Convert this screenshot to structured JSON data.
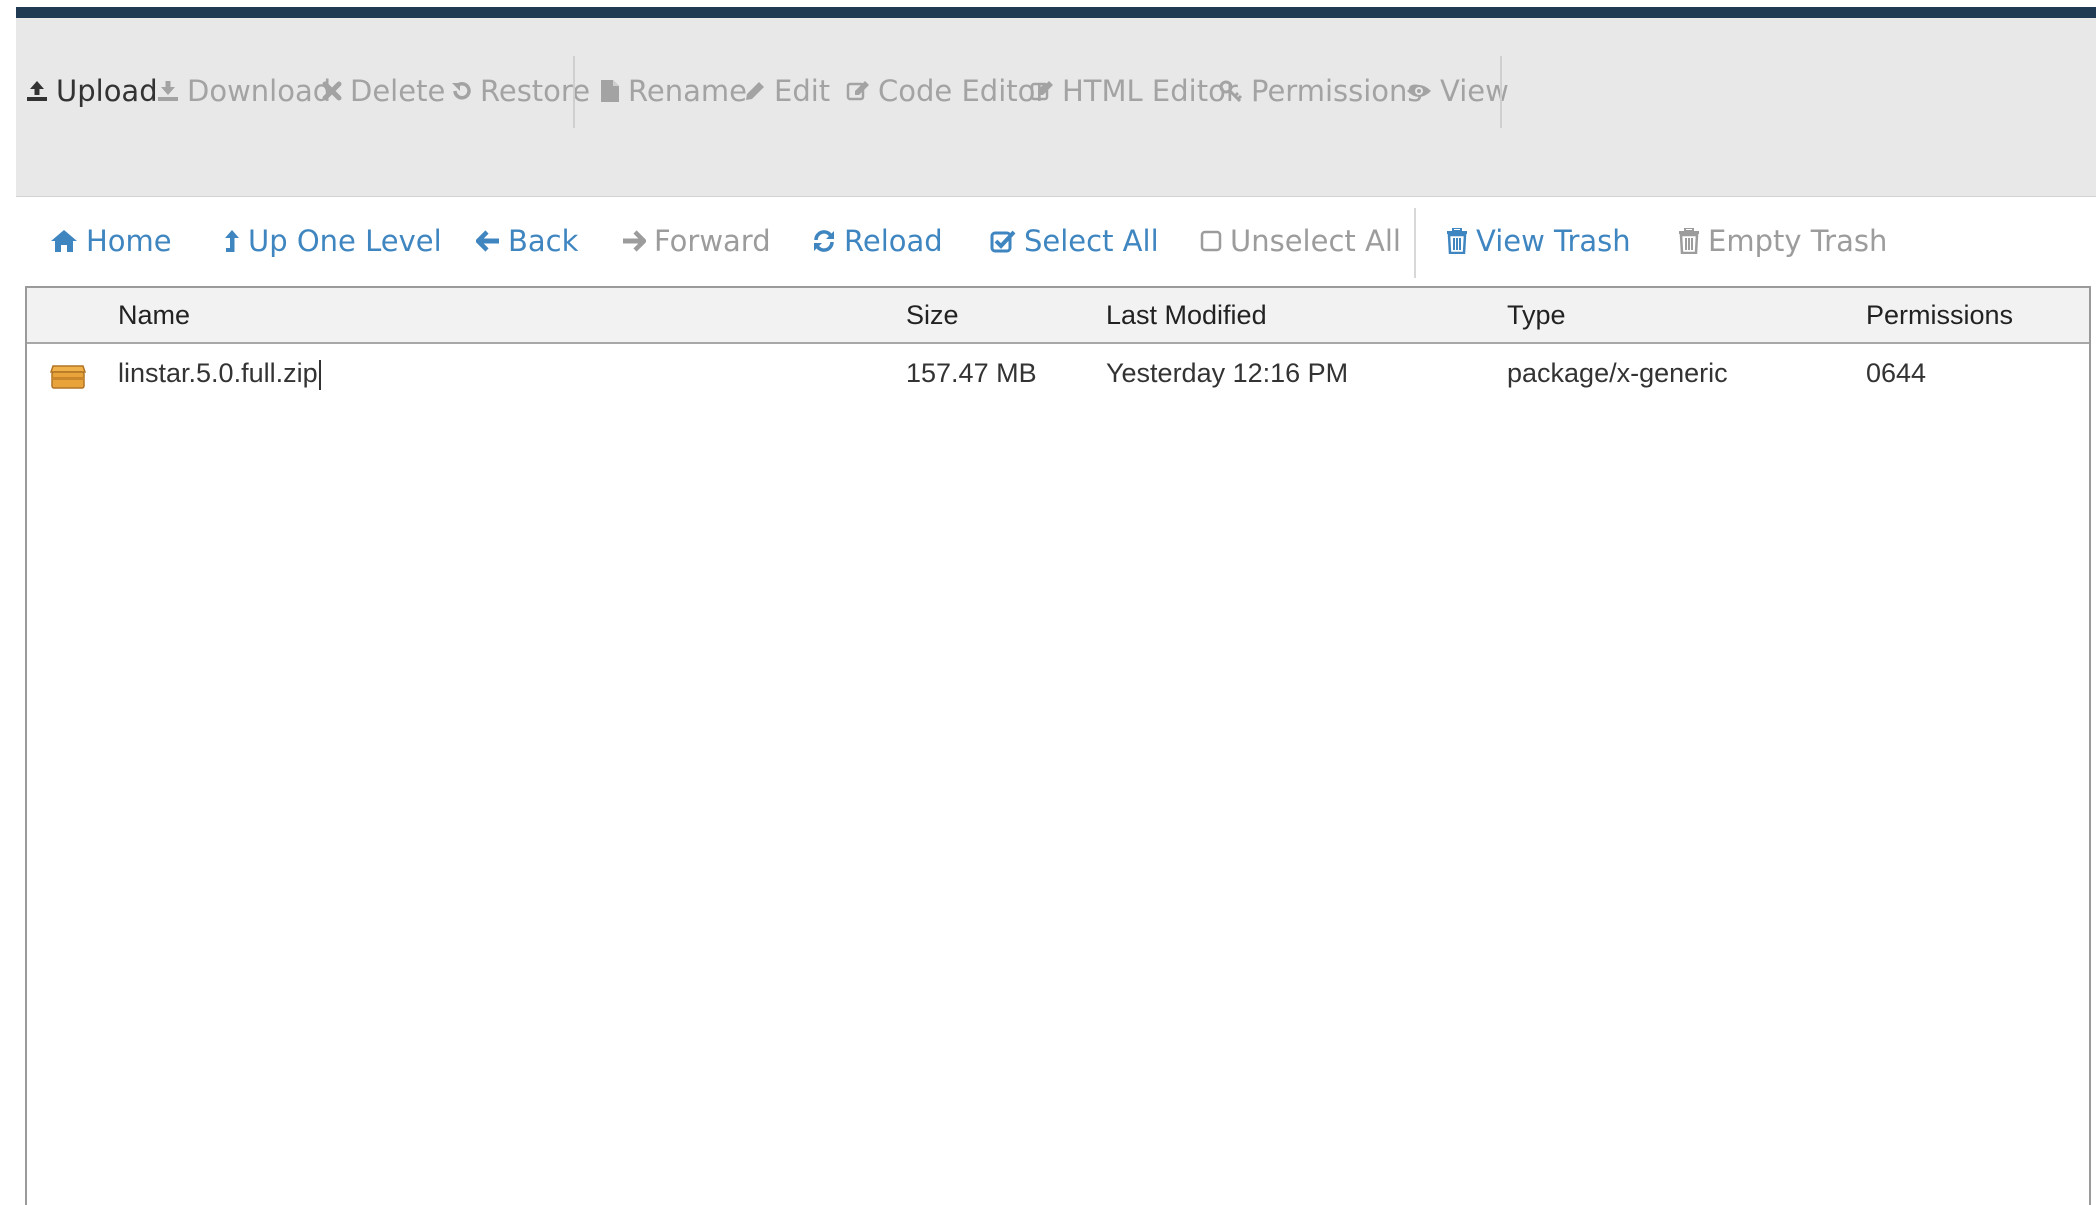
{
  "toolbar": {
    "upload": "Upload",
    "download": "Download",
    "delete": "Delete",
    "restore": "Restore",
    "rename": "Rename",
    "edit": "Edit",
    "code_editor": "Code Editor",
    "html_editor": "HTML Editor",
    "permissions": "Permissions",
    "view": "View"
  },
  "nav": {
    "home": "Home",
    "up_one_level": "Up One Level",
    "back": "Back",
    "forward": "Forward",
    "reload": "Reload",
    "select_all": "Select All",
    "unselect_all": "Unselect All",
    "view_trash": "View Trash",
    "empty_trash": "Empty Trash"
  },
  "table": {
    "columns": {
      "name": "Name",
      "size": "Size",
      "last_modified": "Last Modified",
      "type": "Type",
      "permissions": "Permissions"
    },
    "rows": [
      {
        "icon": "package-icon",
        "name": "linstar.5.0.full.zip",
        "size": "157.47 MB",
        "last_modified": "Yesterday 12:16 PM",
        "type": "package/x-generic",
        "permissions": "0644"
      }
    ]
  },
  "colors": {
    "topbar": "#1f3a52",
    "toolbar_bg": "#e8e8e8",
    "link_blue": "#3f86c1",
    "disabled_gray": "#a3a3a3",
    "package_icon": "#e8a33a"
  }
}
